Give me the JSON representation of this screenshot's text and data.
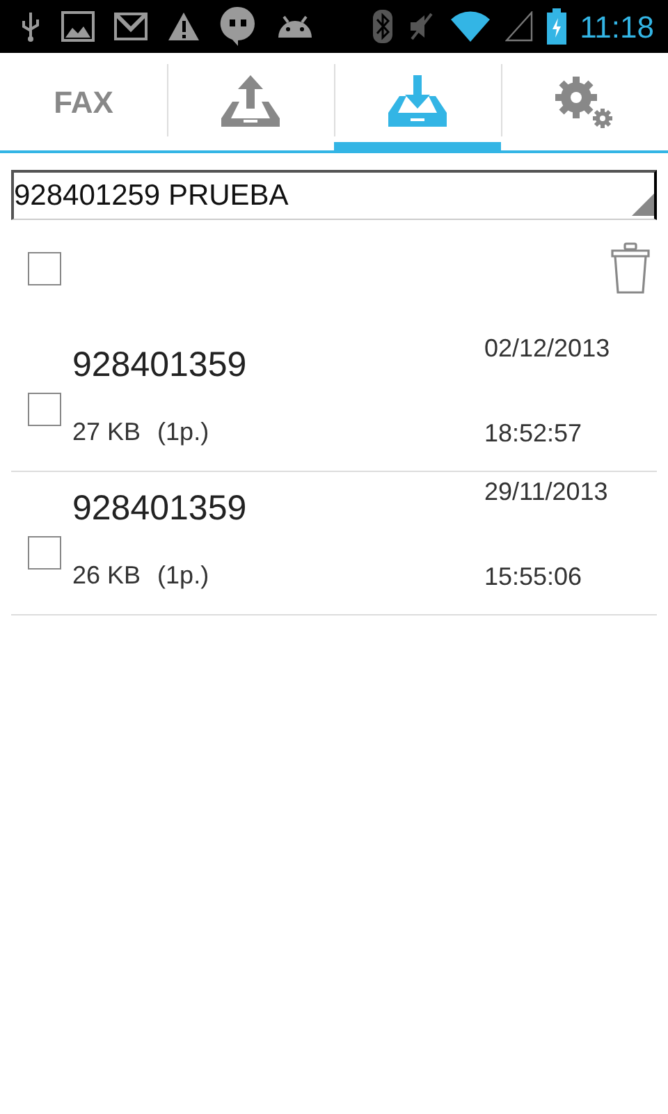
{
  "status_bar": {
    "time": "11:18"
  },
  "tabs": [
    {
      "kind": "text",
      "label": "FAX",
      "selected": false
    },
    {
      "kind": "upload",
      "selected": false
    },
    {
      "kind": "download",
      "selected": true
    },
    {
      "kind": "settings",
      "selected": false
    }
  ],
  "spinner": {
    "value": "928401259 PRUEBA"
  },
  "select_all": {
    "checked": false
  },
  "faxes": [
    {
      "number": "928401359",
      "size": "27 KB",
      "pages": "(1p.)",
      "date": "02/12/2013",
      "time": "18:52:57",
      "checked": false
    },
    {
      "number": "928401359",
      "size": "26 KB",
      "pages": "(1p.)",
      "date": "29/11/2013",
      "time": "15:55:06",
      "checked": false
    }
  ]
}
